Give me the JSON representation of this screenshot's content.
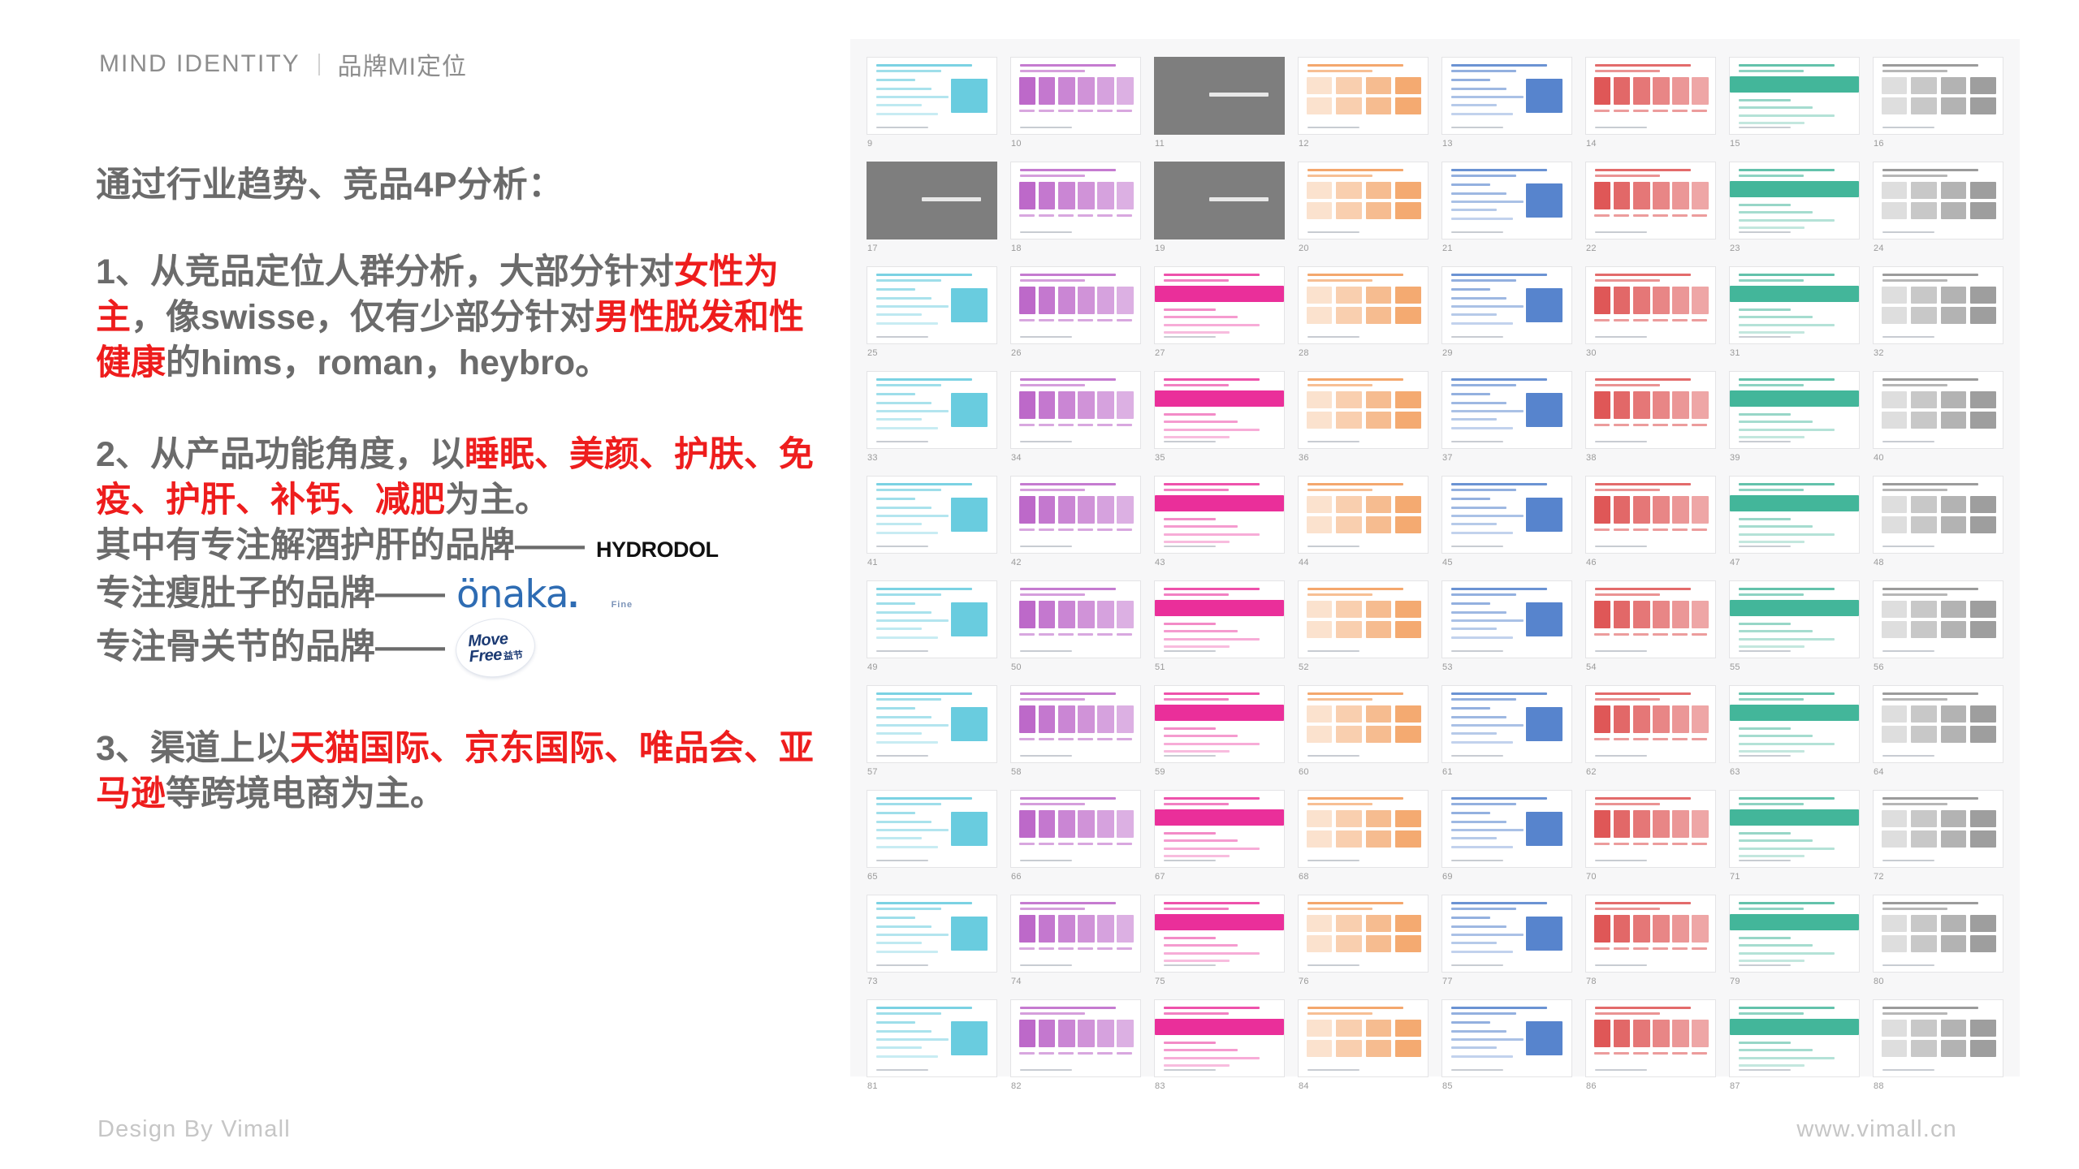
{
  "header": {
    "title_en": "MIND IDENTITY",
    "separator": "|",
    "title_cn": "品牌MI定位"
  },
  "body": {
    "lead": "通过行业趋势、竞品4P分析：",
    "paragraph1": {
      "segments": [
        {
          "text": "1、从竞品定位人群分析，大部分针对",
          "highlight": false
        },
        {
          "text": "女性为主",
          "highlight": true
        },
        {
          "text": "，像swisse，仅有少部分针对",
          "highlight": false
        },
        {
          "text": "男性脱发和性健康",
          "highlight": true
        },
        {
          "text": "的hims，roman，heybro。",
          "highlight": false
        }
      ]
    },
    "paragraph2": {
      "segments": [
        {
          "text": "2、从产品功能角度，以",
          "highlight": false
        },
        {
          "text": "睡眠、美颜、护肤、免疫、护肝、补钙、减肥",
          "highlight": true
        },
        {
          "text": "为主。",
          "highlight": false
        }
      ],
      "brand_lines": [
        {
          "text": "其中有专注解酒护肝的品牌——",
          "logo": "hydrodol-logo"
        },
        {
          "text": "专注瘦肚子的品牌——",
          "logo": "onaka-logo"
        },
        {
          "text": "专注骨关节的品牌——",
          "logo": "movefree-logo"
        }
      ]
    },
    "paragraph3": {
      "segments": [
        {
          "text": "3、渠道上以",
          "highlight": false
        },
        {
          "text": "天猫国际、京东国际、唯品会、亚马逊",
          "highlight": true
        },
        {
          "text": "等跨境电商为主。",
          "highlight": false
        }
      ]
    }
  },
  "logos": {
    "hydrodol": {
      "word": "HYDRODOL",
      "bar_top_color": "#22b3e6",
      "bar_bottom_color": "#e8188f"
    },
    "onaka": {
      "word": "önaka",
      "dot": ".",
      "sub": "Fine",
      "color": "#2e6cb3"
    },
    "movefree": {
      "line1": "Move",
      "line2": "Free",
      "cn": "益节",
      "color": "#1b3a73"
    }
  },
  "colors": {
    "highlight_red": "#ee1d1d",
    "body_gray": "#6b6b6b",
    "header_gray": "#8d8d8d",
    "footer_gray": "#c6c6c6",
    "panel_bg": "#f7f7f8"
  },
  "thumbnail_grid": {
    "columns": 8,
    "rows": 10,
    "first_slide_number": 9,
    "last_slide_number": 88,
    "slides": [
      {
        "n": "9",
        "style": "light"
      },
      {
        "n": "10",
        "style": "light"
      },
      {
        "n": "11",
        "style": "gray"
      },
      {
        "n": "12",
        "style": "light"
      },
      {
        "n": "13",
        "style": "light"
      },
      {
        "n": "14",
        "style": "light"
      },
      {
        "n": "15",
        "style": "light"
      },
      {
        "n": "16",
        "style": "light"
      },
      {
        "n": "17",
        "style": "gray"
      },
      {
        "n": "18",
        "style": "light"
      },
      {
        "n": "19",
        "style": "gray"
      },
      {
        "n": "20",
        "style": "light"
      },
      {
        "n": "21",
        "style": "light"
      },
      {
        "n": "22",
        "style": "light"
      },
      {
        "n": "23",
        "style": "light"
      },
      {
        "n": "24",
        "style": "light"
      },
      {
        "n": "25",
        "style": "light"
      },
      {
        "n": "26",
        "style": "light"
      },
      {
        "n": "27",
        "style": "light"
      },
      {
        "n": "28",
        "style": "light"
      },
      {
        "n": "29",
        "style": "light"
      },
      {
        "n": "30",
        "style": "light"
      },
      {
        "n": "31",
        "style": "light"
      },
      {
        "n": "32",
        "style": "light"
      },
      {
        "n": "33",
        "style": "light"
      },
      {
        "n": "34",
        "style": "light"
      },
      {
        "n": "35",
        "style": "light"
      },
      {
        "n": "36",
        "style": "light"
      },
      {
        "n": "37",
        "style": "light"
      },
      {
        "n": "38",
        "style": "light"
      },
      {
        "n": "39",
        "style": "light"
      },
      {
        "n": "40",
        "style": "light"
      },
      {
        "n": "41",
        "style": "light"
      },
      {
        "n": "42",
        "style": "light"
      },
      {
        "n": "43",
        "style": "light"
      },
      {
        "n": "44",
        "style": "light"
      },
      {
        "n": "45",
        "style": "light"
      },
      {
        "n": "46",
        "style": "light"
      },
      {
        "n": "47",
        "style": "light"
      },
      {
        "n": "48",
        "style": "light"
      },
      {
        "n": "49",
        "style": "light"
      },
      {
        "n": "50",
        "style": "light"
      },
      {
        "n": "51",
        "style": "light"
      },
      {
        "n": "52",
        "style": "light"
      },
      {
        "n": "53",
        "style": "light"
      },
      {
        "n": "54",
        "style": "light"
      },
      {
        "n": "55",
        "style": "light"
      },
      {
        "n": "56",
        "style": "light"
      },
      {
        "n": "57",
        "style": "light"
      },
      {
        "n": "58",
        "style": "light"
      },
      {
        "n": "59",
        "style": "light"
      },
      {
        "n": "60",
        "style": "light"
      },
      {
        "n": "61",
        "style": "light"
      },
      {
        "n": "62",
        "style": "light"
      },
      {
        "n": "63",
        "style": "light"
      },
      {
        "n": "64",
        "style": "light"
      },
      {
        "n": "65",
        "style": "light"
      },
      {
        "n": "66",
        "style": "light"
      },
      {
        "n": "67",
        "style": "light"
      },
      {
        "n": "68",
        "style": "light"
      },
      {
        "n": "69",
        "style": "light"
      },
      {
        "n": "70",
        "style": "light"
      },
      {
        "n": "71",
        "style": "light"
      },
      {
        "n": "72",
        "style": "light"
      },
      {
        "n": "73",
        "style": "light"
      },
      {
        "n": "74",
        "style": "light"
      },
      {
        "n": "75",
        "style": "light"
      },
      {
        "n": "76",
        "style": "light"
      },
      {
        "n": "77",
        "style": "light"
      },
      {
        "n": "78",
        "style": "light"
      },
      {
        "n": "79",
        "style": "light"
      },
      {
        "n": "80",
        "style": "light"
      },
      {
        "n": "81",
        "style": "light"
      },
      {
        "n": "82",
        "style": "light"
      },
      {
        "n": "83",
        "style": "light"
      },
      {
        "n": "84",
        "style": "light"
      },
      {
        "n": "85",
        "style": "light"
      },
      {
        "n": "86",
        "style": "light"
      },
      {
        "n": "87",
        "style": "light"
      },
      {
        "n": "88",
        "style": "light"
      }
    ]
  },
  "footer": {
    "left": "Design By Vimall",
    "right": "www.vimall.cn"
  }
}
